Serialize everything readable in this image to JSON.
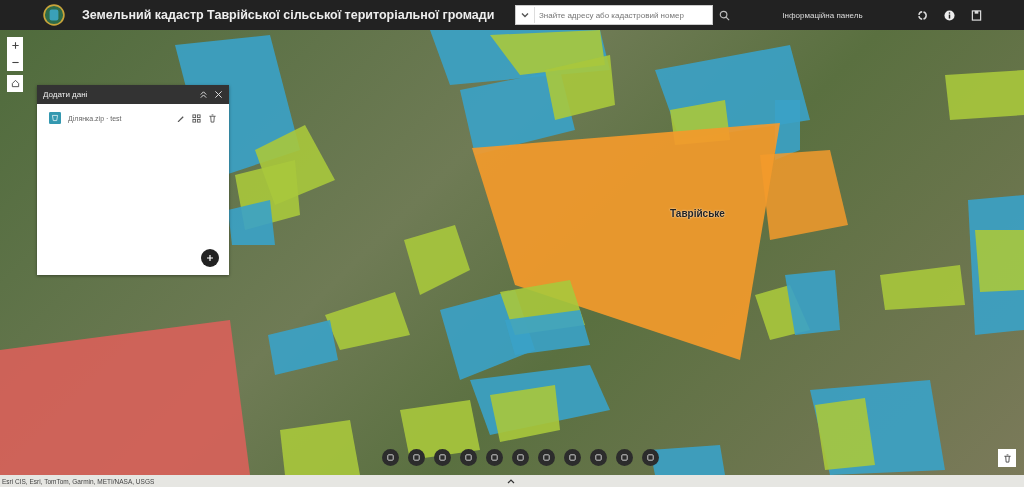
{
  "header": {
    "title": "Земельний кадастр Таврійської сільської територіальної громади",
    "search": {
      "placeholder": "Знайте адресу або кадастровий номер"
    },
    "info_panel": "Інформаційна панель"
  },
  "panel": {
    "title": "Додати дані",
    "items": [
      {
        "name": "Ділянка.zip · test"
      }
    ]
  },
  "map": {
    "place_label": "Таврійське",
    "attribution": "Esri CIS, Esri, TomTom, Garmin, METI/NASA, USGS"
  }
}
